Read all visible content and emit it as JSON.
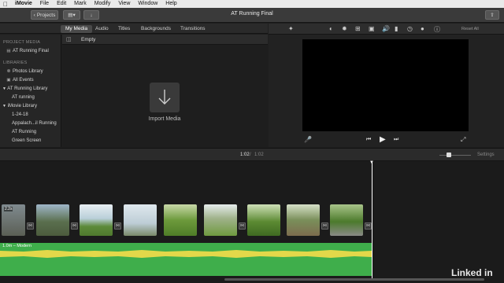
{
  "menubar": {
    "items": [
      "iMovie",
      "File",
      "Edit",
      "Mark",
      "Modify",
      "View",
      "Window",
      "Help"
    ]
  },
  "toolbar": {
    "projects_label": "Projects",
    "title": "AT Running Final"
  },
  "browser": {
    "tabs": [
      "My Media",
      "Audio",
      "Titles",
      "Backgrounds",
      "Transitions"
    ],
    "filter_label": "Empty",
    "import_label": "Import Media"
  },
  "sidebar": {
    "project_media_header": "PROJECT MEDIA",
    "project_item": "AT Running Final",
    "libraries_header": "LIBRARIES",
    "items": [
      {
        "label": "Photos Library"
      },
      {
        "label": "All Events"
      },
      {
        "label": "AT Running Library"
      },
      {
        "label": "AT running"
      },
      {
        "label": "iMovie Library"
      },
      {
        "label": "1-24-18"
      },
      {
        "label": "Appalach...il Running"
      },
      {
        "label": "AT Running"
      },
      {
        "label": "Green Screen"
      }
    ]
  },
  "viewer": {
    "reset_all_label": "Reset All"
  },
  "timeline": {
    "timecode": "1:02",
    "duration": "1:02",
    "settings_label": "Settings",
    "first_clip_badge": "2.2s",
    "audio_label": "1.0m – Modern"
  },
  "watermark": "Linked in",
  "colors": {
    "audio_green": "#3fae4b",
    "audio_wave_yellow": "#e3d84a"
  }
}
